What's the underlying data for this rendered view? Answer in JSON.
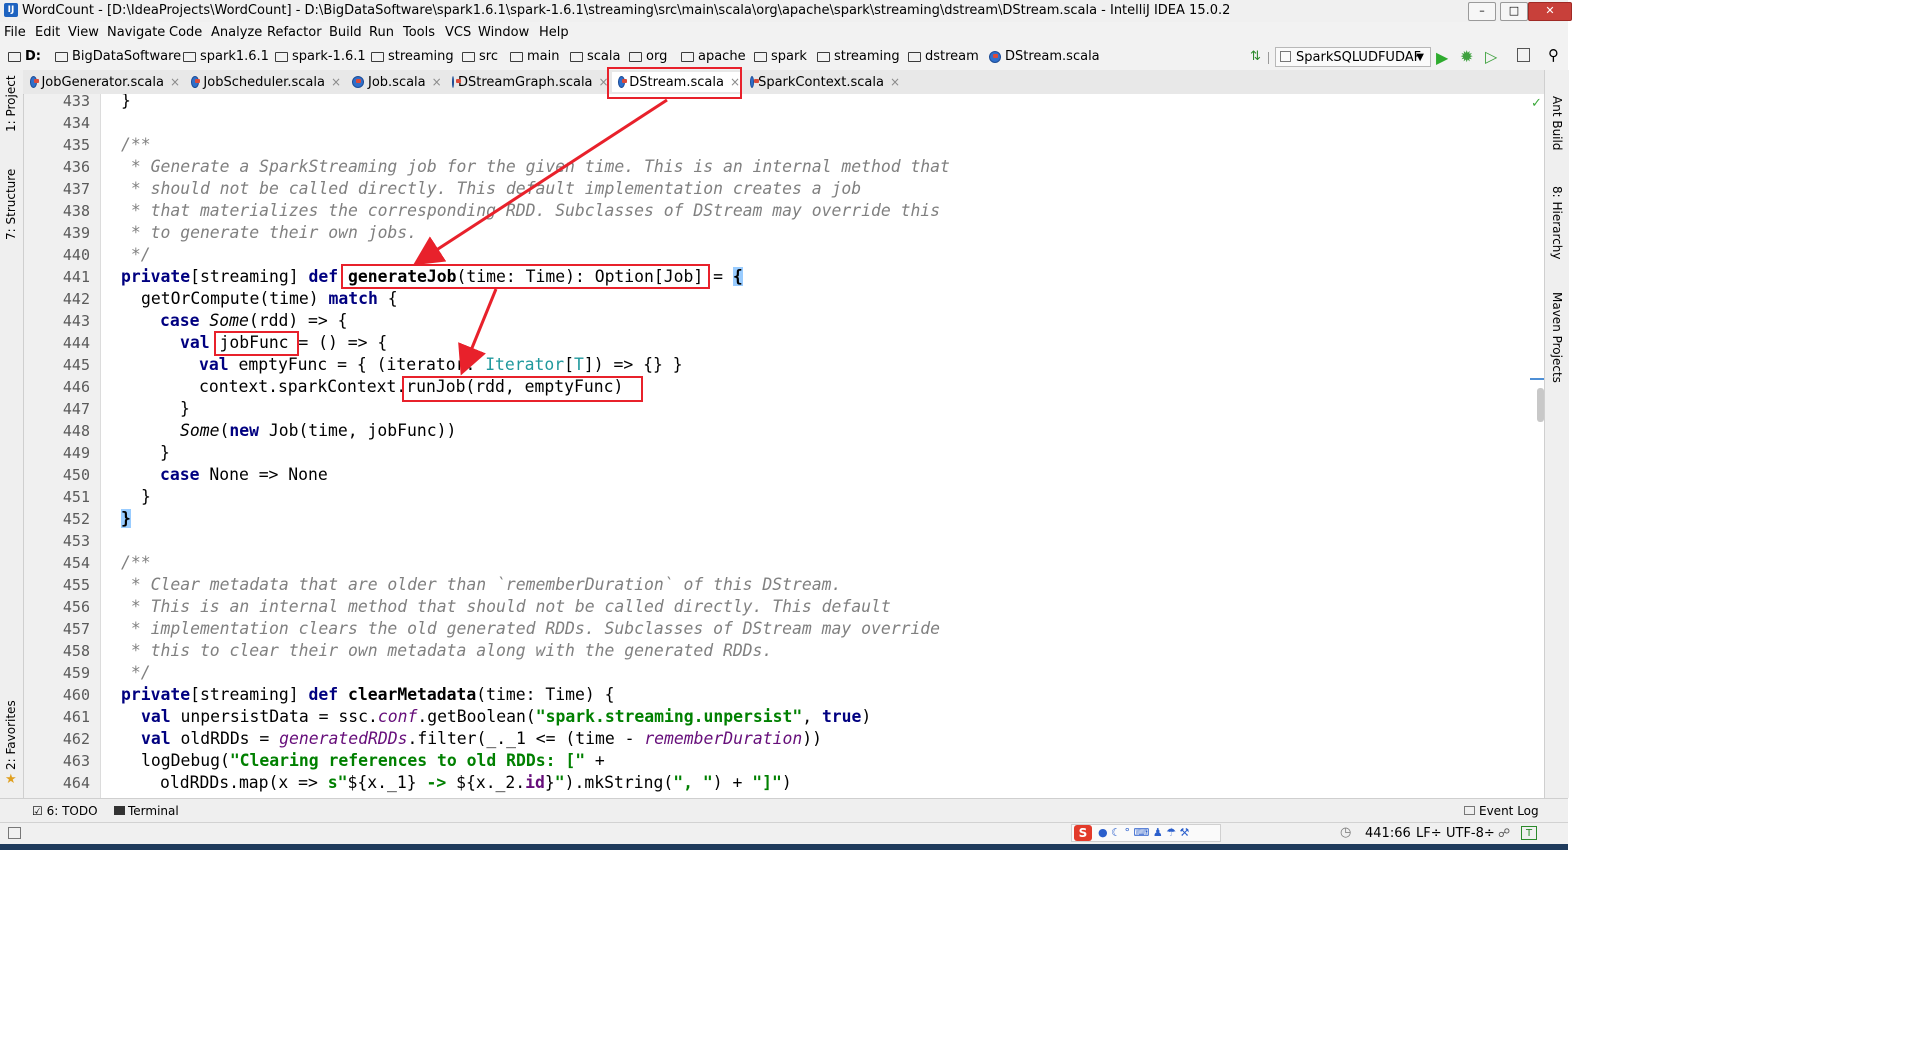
{
  "window": {
    "title": "WordCount - [D:\\IdeaProjects\\WordCount] - D:\\BigDataSoftware\\spark1.6.1\\spark-1.6.1\\streaming\\src\\main\\scala\\org\\apache\\spark\\streaming\\dstream\\DStream.scala - IntelliJ IDEA 15.0.2"
  },
  "menu": [
    "File",
    "Edit",
    "View",
    "Navigate",
    "Code",
    "Analyze",
    "Refactor",
    "Build",
    "Run",
    "Tools",
    "VCS",
    "Window",
    "Help"
  ],
  "breadcrumbs": {
    "drive": "D:",
    "items": [
      "BigDataSoftware",
      "spark1.6.1",
      "spark-1.6.1",
      "streaming",
      "src",
      "main",
      "scala",
      "org",
      "apache",
      "spark",
      "streaming",
      "dstream"
    ],
    "file": "DStream.scala"
  },
  "toolbar": {
    "run_config": "SparkSQLUDFUDAF"
  },
  "tabs": [
    "JobGenerator.scala",
    "JobScheduler.scala",
    "Job.scala",
    "DStreamGraph.scala",
    "DStream.scala",
    "SparkContext.scala"
  ],
  "active_tab": "DStream.scala",
  "left_tools": [
    "1: Project",
    "7: Structure",
    "2: Favorites"
  ],
  "right_tools": [
    "Ant Build",
    "8: Hierarchy",
    "Maven Projects"
  ],
  "editor": {
    "line_numbers": [
      "433",
      "434",
      "435",
      "436",
      "437",
      "438",
      "439",
      "440",
      "441",
      "442",
      "443",
      "444",
      "445",
      "446",
      "447",
      "448",
      "449",
      "450",
      "451",
      "452",
      "453",
      "454",
      "455",
      "456",
      "457",
      "458",
      "459",
      "460",
      "461",
      "462",
      "463",
      "464"
    ],
    "line_texts": {
      "l436": " * Generate a SparkStreaming job for the given time. This is an internal method that",
      "l437": " * should not be called directly. This default implementation creates a job",
      "l438": " * that materializes the corresponding RDD. Subclasses of DStream may override this",
      "l439": " * to generate their own jobs.",
      "l455": " * Clear metadata that are older than `rememberDuration` of this DStream.",
      "l456": " * This is an internal method that should not be called directly. This default",
      "l457": " * implementation clears the old generated RDDs. Subclasses of DStream may override",
      "l458": " * this to clear their own metadata along with the generated RDDs."
    }
  },
  "bottom_tools": {
    "todo": "6: TODO",
    "terminal": "Terminal",
    "event_log": "Event Log"
  },
  "status": {
    "position": "441:66",
    "line_sep": "LF÷",
    "encoding": "UTF-8÷"
  },
  "colors": {
    "annotation": "#e8212b",
    "keyword": "#000080",
    "comment": "#808080",
    "string": "#008000",
    "field": "#660e7a"
  }
}
